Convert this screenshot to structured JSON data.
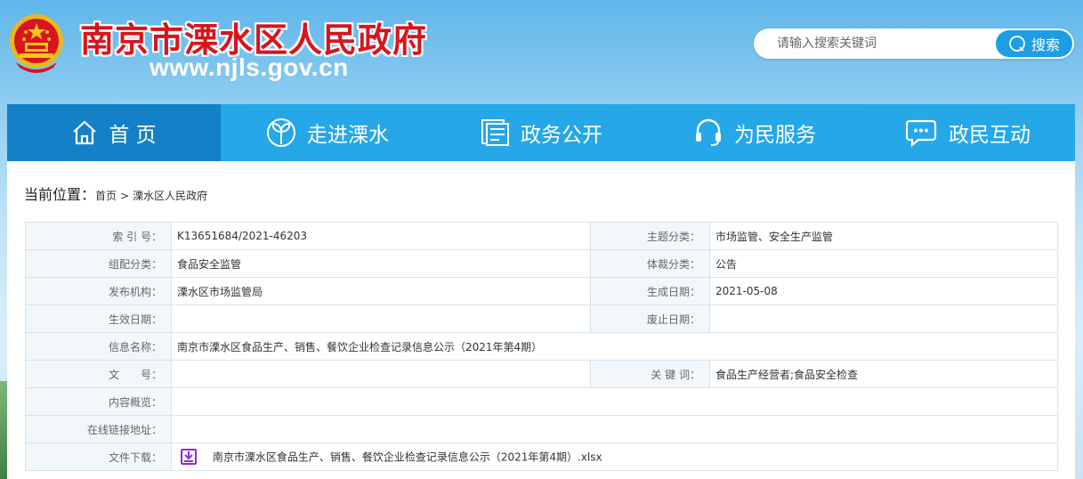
{
  "header": {
    "title": "南京市溧水区人民政府",
    "url": "www.njls.gov.cn",
    "search": {
      "placeholder": "请输入搜索关键词",
      "button": "搜索"
    }
  },
  "nav": [
    {
      "label": "首 页",
      "icon": "home-icon",
      "active": true
    },
    {
      "label": "走进溧水",
      "icon": "sprout-icon",
      "active": false
    },
    {
      "label": "政务公开",
      "icon": "document-icon",
      "active": false
    },
    {
      "label": "为民服务",
      "icon": "headset-icon",
      "active": false
    },
    {
      "label": "政民互动",
      "icon": "chat-icon",
      "active": false
    }
  ],
  "breadcrumb": {
    "lead": "当前位置：",
    "items": [
      "首页",
      "溧水区人民政府"
    ],
    "separator": ">"
  },
  "meta": {
    "index_label": "索 引 号：",
    "index": "K13651684/2021-46203",
    "topic_label": "主题分类：",
    "topic": "市场监管、安全生产监管",
    "group_label": "组配分类：",
    "group": "食品安全监管",
    "genre_label": "体裁分类：",
    "genre": "公告",
    "publisher_label": "发布机构：",
    "publisher": "溧水区市场监管局",
    "created_label": "生成日期：",
    "created": "2021-05-08",
    "effective_label": "生效日期：",
    "effective": "",
    "expired_label": "废止日期：",
    "expired": "",
    "name_label": "信息名称：",
    "name": "南京市溧水区食品生产、销售、餐饮企业检查记录信息公示（2021年第4期）",
    "docno_label": "文　　号：",
    "docno": "",
    "keywords_label": "关 键 词：",
    "keywords": "食品生产经营者;食品安全检查",
    "summary_label": "内容概览：",
    "summary": "",
    "link_label": "在线链接地址：",
    "link": "",
    "download_label": "文件下载：",
    "download": "南京市溧水区食品生产、销售、餐饮企业检查记录信息公示（2021年第4期）.xlsx"
  },
  "colors": {
    "title_red": "#d8141c",
    "nav_blue": "#25a7e8",
    "nav_active": "#1480c8",
    "download_icon": "#8a2be2"
  }
}
